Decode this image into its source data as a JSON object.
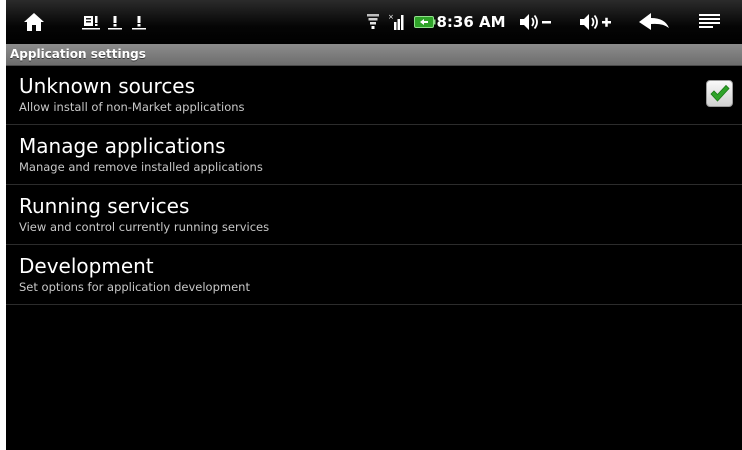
{
  "status_bar": {
    "time": "8:36 AM",
    "icons": [
      "home-icon",
      "notification-icon",
      "warning-icon",
      "warning-icon",
      "wifi-icon",
      "signal-icon",
      "battery-icon",
      "volume-down-icon",
      "volume-up-icon",
      "back-icon",
      "menu-icon"
    ]
  },
  "title_bar": {
    "title": "Application settings"
  },
  "settings": [
    {
      "title": "Unknown sources",
      "summary": "Allow install of non-Market applications",
      "checked": true
    },
    {
      "title": "Manage applications",
      "summary": "Manage and remove installed applications"
    },
    {
      "title": "Running services",
      "summary": "View and control currently running services"
    },
    {
      "title": "Development",
      "summary": "Set options for application development"
    }
  ],
  "colors": {
    "background": "#000000",
    "title_bar": "#7d7d7d",
    "check_mark": "#2fa329"
  }
}
